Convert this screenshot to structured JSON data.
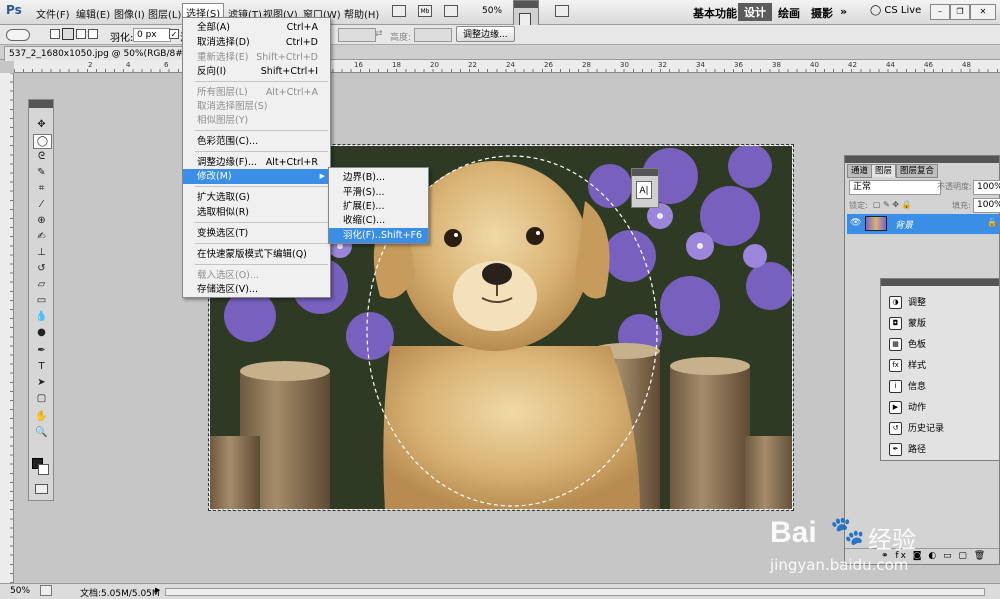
{
  "app": {
    "logo": "Ps",
    "menus": [
      "文件(F)",
      "编辑(E)",
      "图像(I)",
      "图层(L)",
      "选择(S)",
      "滤镜(T)",
      "视图(V)",
      "窗口(W)",
      "帮助(H)"
    ],
    "zoom": "50%",
    "workspaces": [
      "基本功能",
      "设计",
      "绘画",
      "摄影"
    ],
    "more": "»",
    "cslive": "CS Live"
  },
  "options": {
    "feather_label": "羽化:",
    "feather_value": "0 px",
    "antialias_letter": "消",
    "height_label": "高度:",
    "refine_edge": "调整边缘..."
  },
  "document": {
    "tab_title": "537_2_1680x1050.jpg @ 50%(RGB/8#) *",
    "tab_close": "×"
  },
  "select_menu": {
    "items": [
      {
        "label": "全部(A)",
        "shortcut": "Ctrl+A",
        "disabled": false
      },
      {
        "label": "取消选择(D)",
        "shortcut": "Ctrl+D",
        "disabled": false
      },
      {
        "label": "重新选择(E)",
        "shortcut": "Shift+Ctrl+D",
        "disabled": true
      },
      {
        "label": "反向(I)",
        "shortcut": "Shift+Ctrl+I",
        "disabled": false
      },
      {
        "label": "所有图层(L)",
        "shortcut": "Alt+Ctrl+A",
        "disabled": true
      },
      {
        "label": "取消选择图层(S)",
        "shortcut": "",
        "disabled": true
      },
      {
        "label": "相似图层(Y)",
        "shortcut": "",
        "disabled": true
      },
      {
        "label": "色彩范围(C)...",
        "shortcut": "",
        "disabled": false
      },
      {
        "label": "调整边缘(F)...",
        "shortcut": "Alt+Ctrl+R",
        "disabled": false
      },
      {
        "label": "修改(M)",
        "shortcut": "",
        "disabled": false
      },
      {
        "label": "扩大选取(G)",
        "shortcut": "",
        "disabled": false
      },
      {
        "label": "选取相似(R)",
        "shortcut": "",
        "disabled": false
      },
      {
        "label": "变换选区(T)",
        "shortcut": "",
        "disabled": false
      },
      {
        "label": "在快速蒙版模式下编辑(Q)",
        "shortcut": "",
        "disabled": false
      },
      {
        "label": "载入选区(O)...",
        "shortcut": "",
        "disabled": true
      },
      {
        "label": "存储选区(V)...",
        "shortcut": "",
        "disabled": false
      }
    ]
  },
  "modify_menu": {
    "items": [
      {
        "label": "边界(B)...",
        "shortcut": ""
      },
      {
        "label": "平滑(S)...",
        "shortcut": ""
      },
      {
        "label": "扩展(E)...",
        "shortcut": ""
      },
      {
        "label": "收缩(C)...",
        "shortcut": ""
      },
      {
        "label": "羽化(F)...",
        "shortcut": "Shift+F6"
      }
    ]
  },
  "layers_panel": {
    "tabs": [
      "通道",
      "图层",
      "图层复合"
    ],
    "blend_mode": "正常",
    "opacity_label": "不透明度:",
    "opacity_value": "100%",
    "lock_label": "锁定:",
    "fill_label": "填充:",
    "fill_value": "100%",
    "layer_name": "背景"
  },
  "adjust_panel": {
    "items": [
      "调整",
      "蒙版",
      "色板",
      "样式",
      "信息",
      "动作",
      "历史记录",
      "路径"
    ]
  },
  "char_float_label": "A|",
  "status": {
    "zoom": "50%",
    "doc_info": "文档:5.05M/5.05M"
  },
  "watermark": {
    "brand": "Bai",
    "brand_suffix": "经验",
    "url": "jingyan.baidu.com"
  },
  "ruler_numbers": [
    "2",
    "4",
    "6",
    "8",
    "10",
    "12",
    "14",
    "16",
    "18",
    "20",
    "22",
    "24",
    "26",
    "28",
    "30",
    "32",
    "34",
    "36",
    "38",
    "40",
    "42",
    "44",
    "46",
    "48"
  ],
  "colors": {
    "menu_highlight": "#3a8ee6",
    "layer_selected": "#3a8ee6",
    "workspace_selected": "#5c5c5c"
  }
}
